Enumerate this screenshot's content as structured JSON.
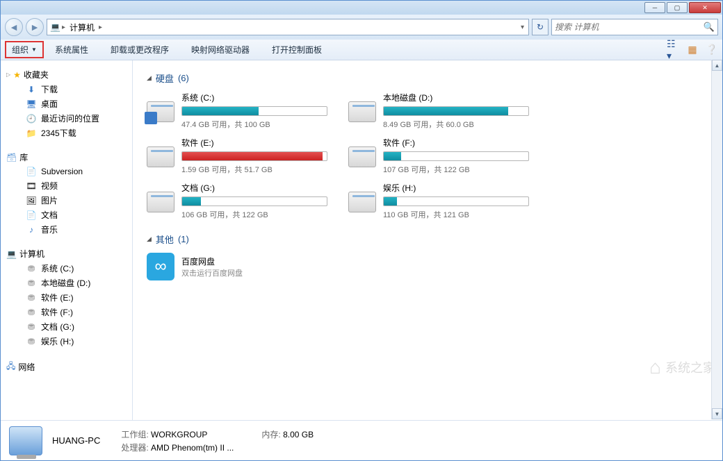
{
  "addr": {
    "location": "计算机"
  },
  "search": {
    "placeholder": "搜索 计算机"
  },
  "toolbar": {
    "organize": "组织",
    "items": [
      "系统属性",
      "卸载或更改程序",
      "映射网络驱动器",
      "打开控制面板"
    ]
  },
  "sidebar": {
    "favorites": {
      "label": "收藏夹",
      "items": [
        "下载",
        "桌面",
        "最近访问的位置",
        "2345下载"
      ]
    },
    "libraries": {
      "label": "库",
      "items": [
        "Subversion",
        "视频",
        "图片",
        "文档",
        "音乐"
      ]
    },
    "computer": {
      "label": "计算机",
      "items": [
        "系统 (C:)",
        "本地磁盘 (D:)",
        "软件 (E:)",
        "软件 (F:)",
        "文档 (G:)",
        "娱乐 (H:)"
      ]
    },
    "network": {
      "label": "网络"
    }
  },
  "sections": {
    "drives": {
      "label": "硬盘",
      "count": "(6)"
    },
    "other": {
      "label": "其他",
      "count": "(1)"
    }
  },
  "drives": [
    {
      "name": "系统 (C:)",
      "stat": "47.4 GB 可用，共 100 GB",
      "pct": 53,
      "color": "teal",
      "sys": true
    },
    {
      "name": "本地磁盘 (D:)",
      "stat": "8.49 GB 可用，共 60.0 GB",
      "pct": 86,
      "color": "teal"
    },
    {
      "name": "软件 (E:)",
      "stat": "1.59 GB 可用，共 51.7 GB",
      "pct": 97,
      "color": "red"
    },
    {
      "name": "软件 (F:)",
      "stat": "107 GB 可用，共 122 GB",
      "pct": 12,
      "color": "teal"
    },
    {
      "name": "文档 (G:)",
      "stat": "106 GB 可用，共 122 GB",
      "pct": 13,
      "color": "teal"
    },
    {
      "name": "娱乐 (H:)",
      "stat": "110 GB 可用，共 121 GB",
      "pct": 9,
      "color": "teal"
    }
  ],
  "other": {
    "name": "百度网盘",
    "sub": "双击运行百度网盘"
  },
  "details": {
    "name": "HUANG-PC",
    "workgroup_label": "工作组:",
    "workgroup": "WORKGROUP",
    "mem_label": "内存:",
    "mem": "8.00 GB",
    "cpu_label": "处理器:",
    "cpu": "AMD Phenom(tm) II ..."
  },
  "watermark": "系统之家"
}
